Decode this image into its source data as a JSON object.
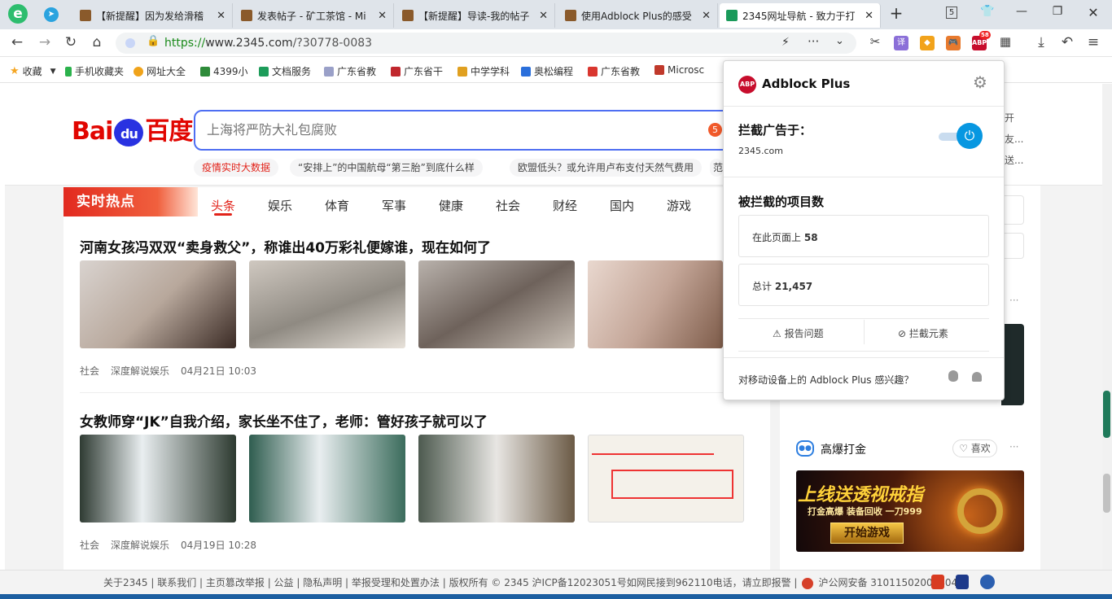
{
  "browser": {
    "tabs": [
      {
        "title": "【新提醒】因为发给滑稽",
        "active": false
      },
      {
        "title": "发表帖子 - 矿工茶馆 - Mi",
        "active": false
      },
      {
        "title": "【新提醒】导读-我的帖子",
        "active": false
      },
      {
        "title": "使用Adblock Plus的感受",
        "active": false
      },
      {
        "title": "2345网址导航 - 致力于打",
        "active": true
      }
    ],
    "url_protocol": "https://",
    "url_host": "www.2345.com",
    "url_path": "/?30778-0083",
    "tab_count": "5",
    "abp_badge": "58"
  },
  "bookmarks": [
    {
      "label": "收藏",
      "color": "#f5a623"
    },
    {
      "label": "手机收藏夹",
      "color": "#2bb24c"
    },
    {
      "label": "网址大全",
      "color": "#f0a31a"
    },
    {
      "label": "4399小",
      "color": "#2e8b3a"
    },
    {
      "label": "文档服务",
      "color": "#1d9c5a"
    },
    {
      "label": "广东省教",
      "color": "#9aa0c8"
    },
    {
      "label": "广东省干",
      "color": "#c0272d"
    },
    {
      "label": "中学学科",
      "color": "#e0a020"
    },
    {
      "label": "奥松编程",
      "color": "#2a6fdb"
    },
    {
      "label": "广东省教",
      "color": "#d9362f"
    },
    {
      "label": "Microsc",
      "color": "#c0392b"
    }
  ],
  "search": {
    "placeholder": "上海将严防大礼包腐败",
    "badge": "5",
    "tags": [
      "疫情实时大数据",
      "“安排上”的中国航母“第三胎”到底什么样",
      "欧盟低头？或允许用卢布支付天然气费用",
      "范"
    ]
  },
  "hot": {
    "title": "实时热点",
    "tabs": [
      "头条",
      "娱乐",
      "体育",
      "军事",
      "健康",
      "社会",
      "财经",
      "国内",
      "游戏"
    ]
  },
  "articles": [
    {
      "title": "河南女孩冯双双“卖身救父”，称谁出40万彩礼便嫁谁，现在如何了",
      "category": "社会",
      "source": "深度解说娱乐",
      "time": "04月21日 10:03"
    },
    {
      "title": "女教师穿“JK”自我介绍，家长坐不住了，老师：管好孩子就可以了",
      "category": "社会",
      "source": "深度解说娱乐",
      "time": "04月19日 10:28"
    }
  ],
  "side": {
    "right_text": [
      "开",
      "友...",
      "送..."
    ],
    "game_title": "高爆打金",
    "like_label": "♡ 喜欢",
    "ad_line1": "上线送透视戒指",
    "ad_line2": "打金高爆  装备回收  一刀999",
    "ad_button": "开始游戏",
    "more": "···"
  },
  "footer": {
    "text": "关于2345 | 联系我们 | 主页篡改举报 | 公益 | 隐私声明 | 举报受理和处置办法 | 版权所有 © 2345 沪ICP备12023051号如网民接到962110电话，请立即报警 |",
    "police": "沪公网安备 31011502000404号"
  },
  "abp": {
    "name": "Adblock Plus",
    "logo": "ABP",
    "block_on_label": "拦截广告于：",
    "domain": "2345.com",
    "blocked_title": "被拦截的项目数",
    "on_page_label": "在此页面上",
    "on_page_count": "58",
    "total_label": "总计",
    "total_count": "21,457",
    "report_label": "报告问题",
    "block_element_label": "拦截元素",
    "mobile_text": "对移动设备上的 Adblock Plus 感兴趣？"
  }
}
